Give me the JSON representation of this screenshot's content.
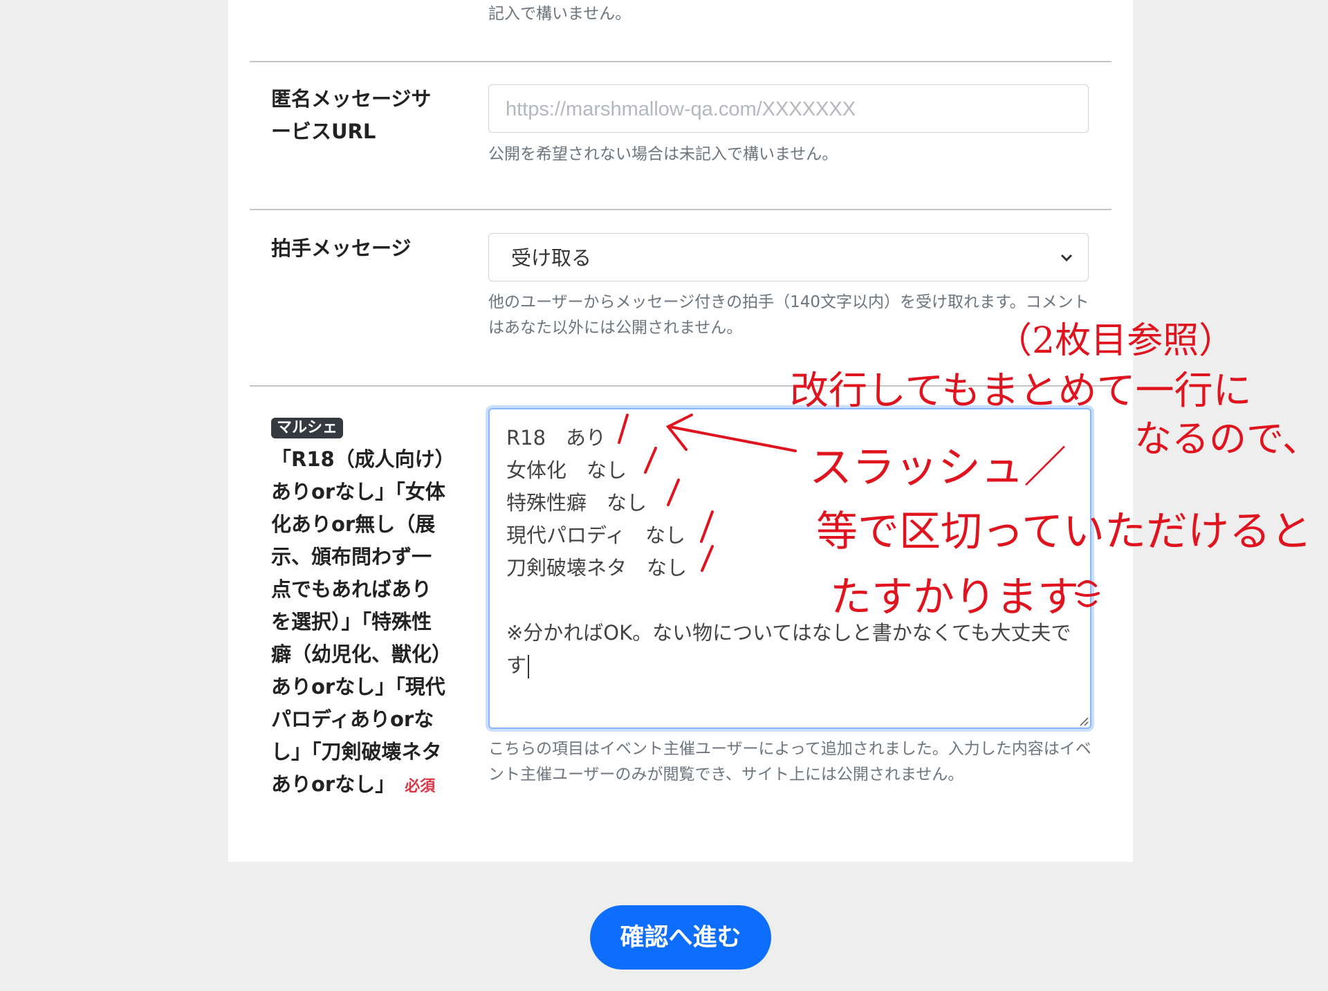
{
  "top_help": "記入で構いません。",
  "anonymous_url": {
    "label": "匿名メッセージサービスURL",
    "placeholder": "https://marshmallow-qa.com/XXXXXXX",
    "help": "公開を希望されない場合は未記入で構いません。"
  },
  "clap_message": {
    "label": "拍手メッセージ",
    "selected": "受け取る",
    "help": "他のユーザーからメッセージ付きの拍手（140文字以内）を受け取れます。コメントはあなた以外には公開されません。"
  },
  "marche_field": {
    "badge": "マルシェ",
    "label": "「R18（成人向け）ありorなし」「女体化ありor無し（展示、頒布問わず一点でもあればありを選択）」「特殊性癖（幼児化、獣化）ありorなし」「現代パロディありorなし」「刀剣破壊ネタありorなし」",
    "required": "必須",
    "textarea_lines": [
      "R18　あり",
      "女体化　なし",
      "特殊性癖　なし",
      "現代パロディ　なし",
      "刀剣破壊ネタ　なし"
    ],
    "textarea_note": "※分かればOK。ない物についてはなしと書かなくても大丈夫です",
    "help": "こちらの項目はイベント主催ユーザーによって追加されました。入力した内容はイベント主催ユーザーのみが閲覧でき、サイト上には公開されません。"
  },
  "submit_label": "確認へ進む",
  "annotation": {
    "line1": "（2枚目参照）",
    "line2": "改行してもまとめて一行に",
    "line3": "なるので、",
    "line4": "スラッシュ／",
    "line5": "等で区切っていただけると",
    "line6": "たすかります",
    "color": "#e0141e"
  }
}
